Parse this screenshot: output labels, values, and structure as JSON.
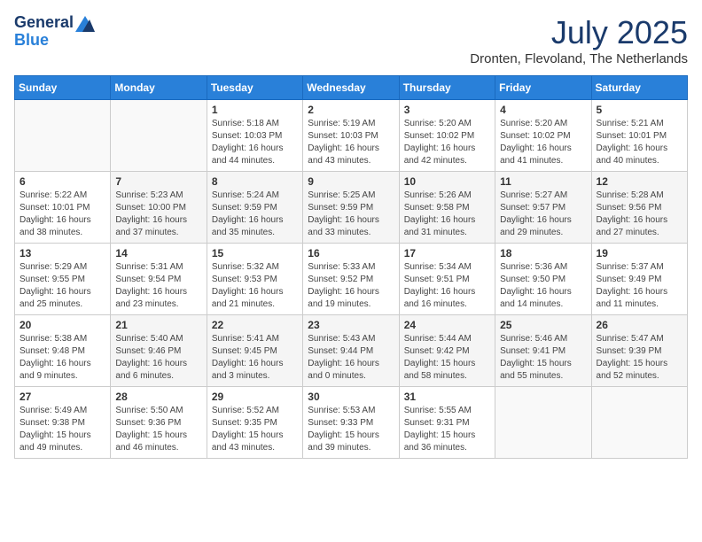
{
  "header": {
    "logo_general": "General",
    "logo_blue": "Blue",
    "month_year": "July 2025",
    "location": "Dronten, Flevoland, The Netherlands"
  },
  "weekdays": [
    "Sunday",
    "Monday",
    "Tuesday",
    "Wednesday",
    "Thursday",
    "Friday",
    "Saturday"
  ],
  "weeks": [
    [
      {
        "day": "",
        "info": ""
      },
      {
        "day": "",
        "info": ""
      },
      {
        "day": "1",
        "info": "Sunrise: 5:18 AM\nSunset: 10:03 PM\nDaylight: 16 hours\nand 44 minutes."
      },
      {
        "day": "2",
        "info": "Sunrise: 5:19 AM\nSunset: 10:03 PM\nDaylight: 16 hours\nand 43 minutes."
      },
      {
        "day": "3",
        "info": "Sunrise: 5:20 AM\nSunset: 10:02 PM\nDaylight: 16 hours\nand 42 minutes."
      },
      {
        "day": "4",
        "info": "Sunrise: 5:20 AM\nSunset: 10:02 PM\nDaylight: 16 hours\nand 41 minutes."
      },
      {
        "day": "5",
        "info": "Sunrise: 5:21 AM\nSunset: 10:01 PM\nDaylight: 16 hours\nand 40 minutes."
      }
    ],
    [
      {
        "day": "6",
        "info": "Sunrise: 5:22 AM\nSunset: 10:01 PM\nDaylight: 16 hours\nand 38 minutes."
      },
      {
        "day": "7",
        "info": "Sunrise: 5:23 AM\nSunset: 10:00 PM\nDaylight: 16 hours\nand 37 minutes."
      },
      {
        "day": "8",
        "info": "Sunrise: 5:24 AM\nSunset: 9:59 PM\nDaylight: 16 hours\nand 35 minutes."
      },
      {
        "day": "9",
        "info": "Sunrise: 5:25 AM\nSunset: 9:59 PM\nDaylight: 16 hours\nand 33 minutes."
      },
      {
        "day": "10",
        "info": "Sunrise: 5:26 AM\nSunset: 9:58 PM\nDaylight: 16 hours\nand 31 minutes."
      },
      {
        "day": "11",
        "info": "Sunrise: 5:27 AM\nSunset: 9:57 PM\nDaylight: 16 hours\nand 29 minutes."
      },
      {
        "day": "12",
        "info": "Sunrise: 5:28 AM\nSunset: 9:56 PM\nDaylight: 16 hours\nand 27 minutes."
      }
    ],
    [
      {
        "day": "13",
        "info": "Sunrise: 5:29 AM\nSunset: 9:55 PM\nDaylight: 16 hours\nand 25 minutes."
      },
      {
        "day": "14",
        "info": "Sunrise: 5:31 AM\nSunset: 9:54 PM\nDaylight: 16 hours\nand 23 minutes."
      },
      {
        "day": "15",
        "info": "Sunrise: 5:32 AM\nSunset: 9:53 PM\nDaylight: 16 hours\nand 21 minutes."
      },
      {
        "day": "16",
        "info": "Sunrise: 5:33 AM\nSunset: 9:52 PM\nDaylight: 16 hours\nand 19 minutes."
      },
      {
        "day": "17",
        "info": "Sunrise: 5:34 AM\nSunset: 9:51 PM\nDaylight: 16 hours\nand 16 minutes."
      },
      {
        "day": "18",
        "info": "Sunrise: 5:36 AM\nSunset: 9:50 PM\nDaylight: 16 hours\nand 14 minutes."
      },
      {
        "day": "19",
        "info": "Sunrise: 5:37 AM\nSunset: 9:49 PM\nDaylight: 16 hours\nand 11 minutes."
      }
    ],
    [
      {
        "day": "20",
        "info": "Sunrise: 5:38 AM\nSunset: 9:48 PM\nDaylight: 16 hours\nand 9 minutes."
      },
      {
        "day": "21",
        "info": "Sunrise: 5:40 AM\nSunset: 9:46 PM\nDaylight: 16 hours\nand 6 minutes."
      },
      {
        "day": "22",
        "info": "Sunrise: 5:41 AM\nSunset: 9:45 PM\nDaylight: 16 hours\nand 3 minutes."
      },
      {
        "day": "23",
        "info": "Sunrise: 5:43 AM\nSunset: 9:44 PM\nDaylight: 16 hours\nand 0 minutes."
      },
      {
        "day": "24",
        "info": "Sunrise: 5:44 AM\nSunset: 9:42 PM\nDaylight: 15 hours\nand 58 minutes."
      },
      {
        "day": "25",
        "info": "Sunrise: 5:46 AM\nSunset: 9:41 PM\nDaylight: 15 hours\nand 55 minutes."
      },
      {
        "day": "26",
        "info": "Sunrise: 5:47 AM\nSunset: 9:39 PM\nDaylight: 15 hours\nand 52 minutes."
      }
    ],
    [
      {
        "day": "27",
        "info": "Sunrise: 5:49 AM\nSunset: 9:38 PM\nDaylight: 15 hours\nand 49 minutes."
      },
      {
        "day": "28",
        "info": "Sunrise: 5:50 AM\nSunset: 9:36 PM\nDaylight: 15 hours\nand 46 minutes."
      },
      {
        "day": "29",
        "info": "Sunrise: 5:52 AM\nSunset: 9:35 PM\nDaylight: 15 hours\nand 43 minutes."
      },
      {
        "day": "30",
        "info": "Sunrise: 5:53 AM\nSunset: 9:33 PM\nDaylight: 15 hours\nand 39 minutes."
      },
      {
        "day": "31",
        "info": "Sunrise: 5:55 AM\nSunset: 9:31 PM\nDaylight: 15 hours\nand 36 minutes."
      },
      {
        "day": "",
        "info": ""
      },
      {
        "day": "",
        "info": ""
      }
    ]
  ]
}
